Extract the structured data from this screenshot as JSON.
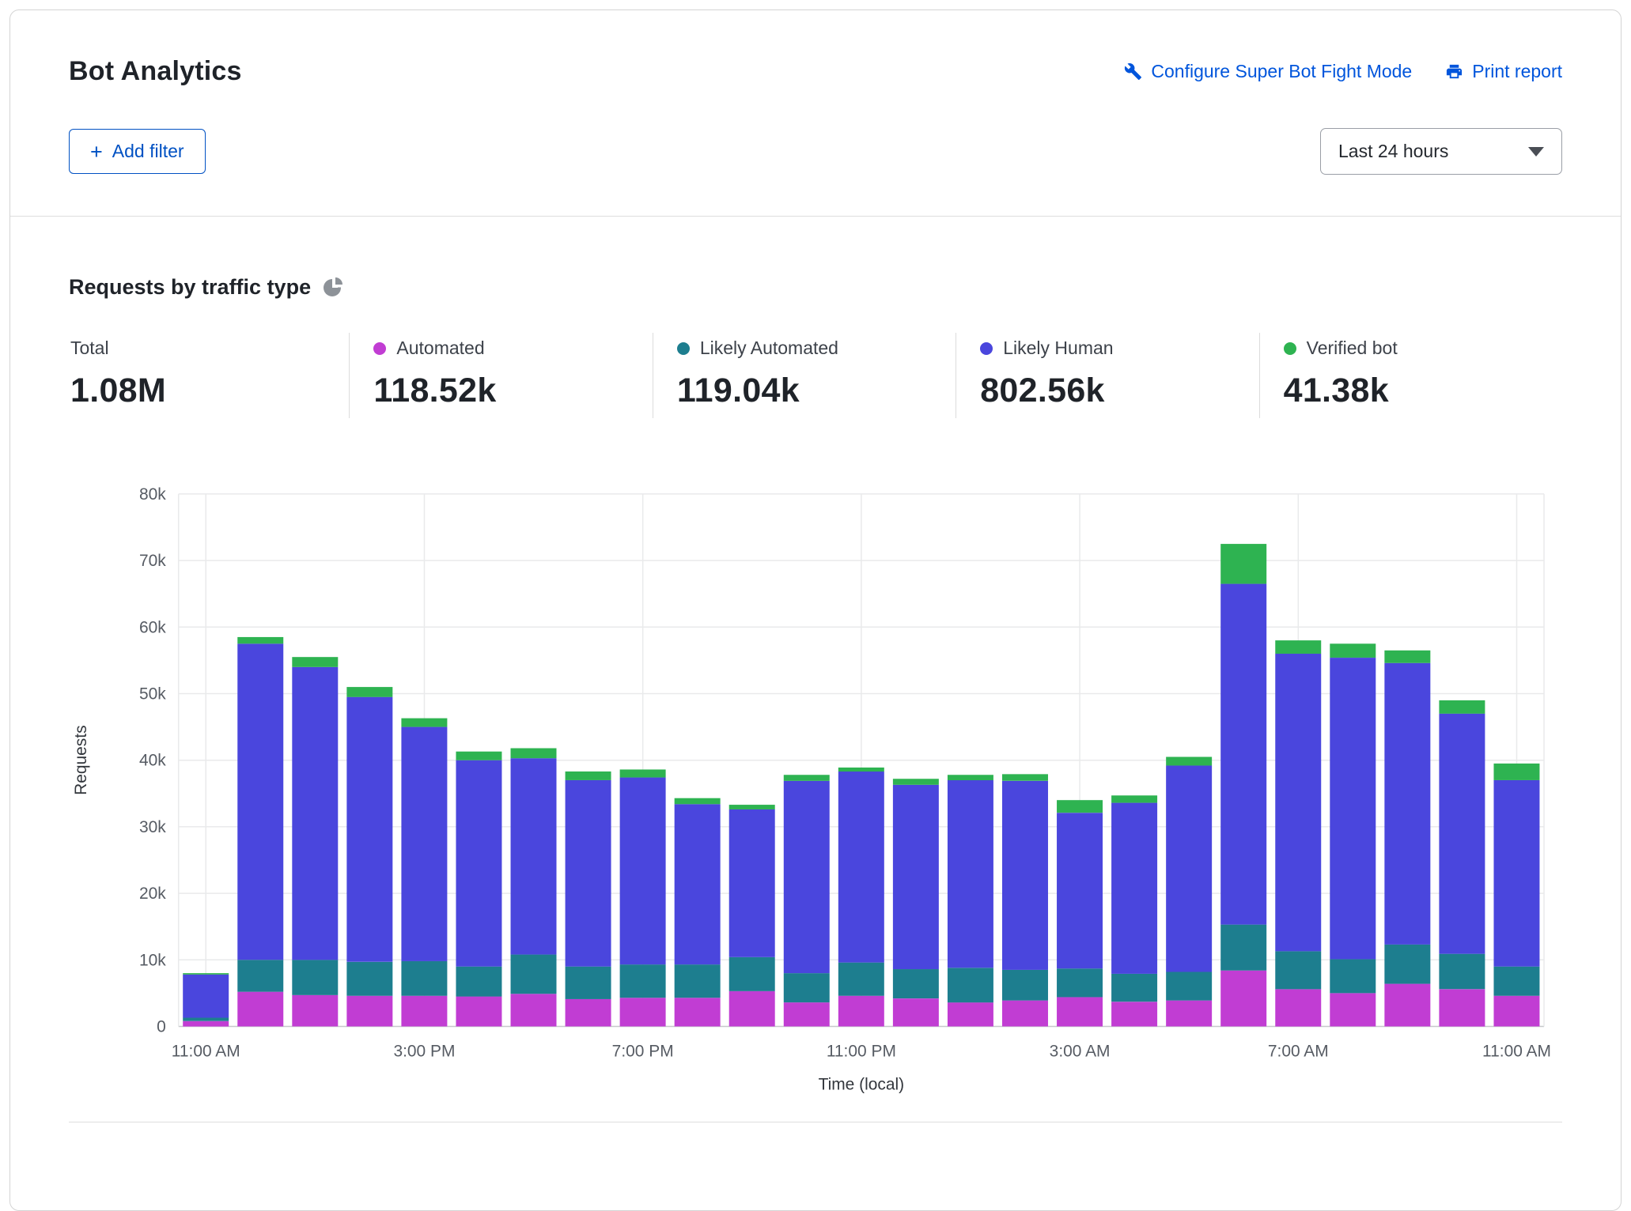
{
  "header": {
    "title": "Bot Analytics",
    "configure_link": "Configure Super Bot Fight Mode",
    "print_link": "Print report",
    "add_filter_plus": "+",
    "add_filter_label": "Add filter",
    "time_range": "Last 24 hours"
  },
  "section": {
    "heading": "Requests by traffic type"
  },
  "stats": [
    {
      "label": "Total",
      "value": "1.08M"
    },
    {
      "label": "Automated",
      "value": "118.52k",
      "color": "#c13dd3"
    },
    {
      "label": "Likely Automated",
      "value": "119.04k",
      "color": "#1d7e8f"
    },
    {
      "label": "Likely Human",
      "value": "802.56k",
      "color": "#4a46dd"
    },
    {
      "label": "Verified bot",
      "value": "41.38k",
      "color": "#2eb351"
    }
  ],
  "chart_data": {
    "type": "bar",
    "stacked": true,
    "title": "Requests by traffic type",
    "xlabel": "Time (local)",
    "ylabel": "Requests",
    "ylim": [
      0,
      80000
    ],
    "ytick_step": 10000,
    "grid": true,
    "categories": [
      "11:00 AM",
      "12:00 PM",
      "1:00 PM",
      "2:00 PM",
      "3:00 PM",
      "4:00 PM",
      "5:00 PM",
      "6:00 PM",
      "7:00 PM",
      "8:00 PM",
      "9:00 PM",
      "10:00 PM",
      "11:00 PM",
      "12:00 AM",
      "1:00 AM",
      "2:00 AM",
      "3:00 AM",
      "4:00 AM",
      "5:00 AM",
      "6:00 AM",
      "7:00 AM",
      "8:00 AM",
      "9:00 AM",
      "10:00 AM",
      "11:00 AM"
    ],
    "x_tick_indices": [
      0,
      4,
      8,
      12,
      16,
      20,
      24
    ],
    "x_tick_labels": [
      "11:00 AM",
      "3:00 PM",
      "7:00 PM",
      "11:00 PM",
      "3:00 AM",
      "7:00 AM",
      "11:00 AM"
    ],
    "series": [
      {
        "name": "Automated",
        "color": "#c13dd3",
        "values": [
          800,
          5200,
          4700,
          4600,
          4600,
          4500,
          4900,
          4100,
          4300,
          4300,
          5300,
          3600,
          4600,
          4200,
          3600,
          3900,
          4400,
          3700,
          3900,
          8400,
          5600,
          5000,
          6400,
          5600,
          4600
        ]
      },
      {
        "name": "Likely Automated",
        "color": "#1d7e8f",
        "values": [
          500,
          4800,
          5300,
          5100,
          5200,
          4500,
          5900,
          4900,
          5000,
          5000,
          5100,
          4400,
          5000,
          4400,
          5200,
          4600,
          4300,
          4200,
          4300,
          6900,
          5700,
          5100,
          5900,
          5300,
          4400
        ]
      },
      {
        "name": "Likely Human",
        "color": "#4a46dd",
        "values": [
          6500,
          47500,
          44000,
          39800,
          35200,
          31000,
          29500,
          28000,
          28100,
          24100,
          22200,
          28900,
          28700,
          27700,
          28200,
          28400,
          23400,
          25700,
          31000,
          51200,
          44700,
          45300,
          42300,
          36100,
          28000
        ]
      },
      {
        "name": "Verified bot",
        "color": "#2eb351",
        "values": [
          200,
          1000,
          1500,
          1500,
          1300,
          1300,
          1500,
          1300,
          1200,
          900,
          700,
          900,
          600,
          900,
          800,
          1000,
          1900,
          1100,
          1300,
          6000,
          2000,
          2100,
          1900,
          2000,
          2500
        ]
      }
    ]
  }
}
